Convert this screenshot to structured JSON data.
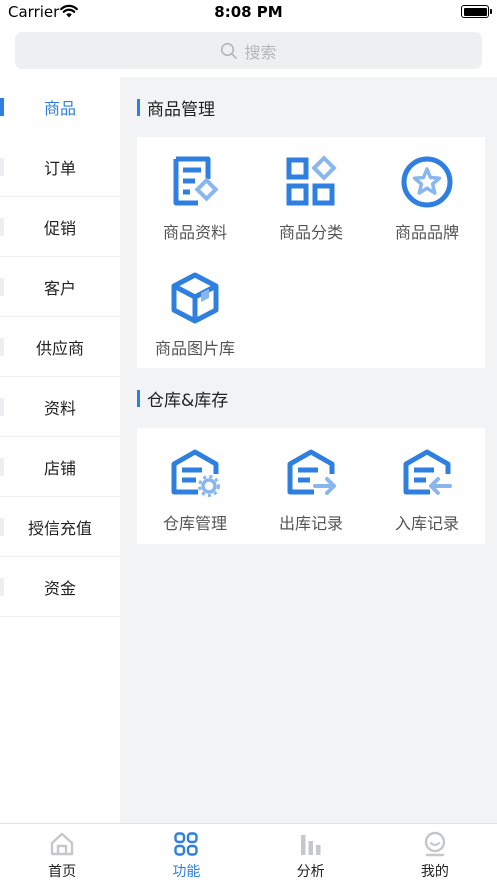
{
  "status_bar": {
    "carrier": "Carrier",
    "time": "8:08 PM"
  },
  "search": {
    "placeholder": "搜索"
  },
  "sidebar": {
    "items": [
      {
        "label": "商品",
        "active": true
      },
      {
        "label": "订单"
      },
      {
        "label": "促销"
      },
      {
        "label": "客户"
      },
      {
        "label": "供应商"
      },
      {
        "label": "资料"
      },
      {
        "label": "店铺"
      },
      {
        "label": "授信充值"
      },
      {
        "label": "资金"
      }
    ]
  },
  "sections": [
    {
      "title": "商品管理",
      "items": [
        {
          "label": "商品资料",
          "icon": "product-info-icon"
        },
        {
          "label": "商品分类",
          "icon": "category-grid-icon"
        },
        {
          "label": "商品品牌",
          "icon": "brand-star-icon"
        },
        {
          "label": "商品图片库",
          "icon": "image-box-icon"
        }
      ]
    },
    {
      "title": "仓库&库存",
      "items": [
        {
          "label": "仓库管理",
          "icon": "warehouse-gear-icon"
        },
        {
          "label": "出库记录",
          "icon": "warehouse-out-icon"
        },
        {
          "label": "入库记录",
          "icon": "warehouse-in-icon"
        }
      ]
    }
  ],
  "tabbar": {
    "items": [
      {
        "label": "首页",
        "icon": "home-icon"
      },
      {
        "label": "功能",
        "icon": "apps-icon",
        "active": true
      },
      {
        "label": "分析",
        "icon": "bar-chart-icon"
      },
      {
        "label": "我的",
        "icon": "profile-icon"
      }
    ]
  },
  "colors": {
    "accent": "#2f7fe0",
    "accent_light": "#8ab6ef",
    "background": "#f2f3f5",
    "inactive_icon": "#c5c7cb"
  }
}
